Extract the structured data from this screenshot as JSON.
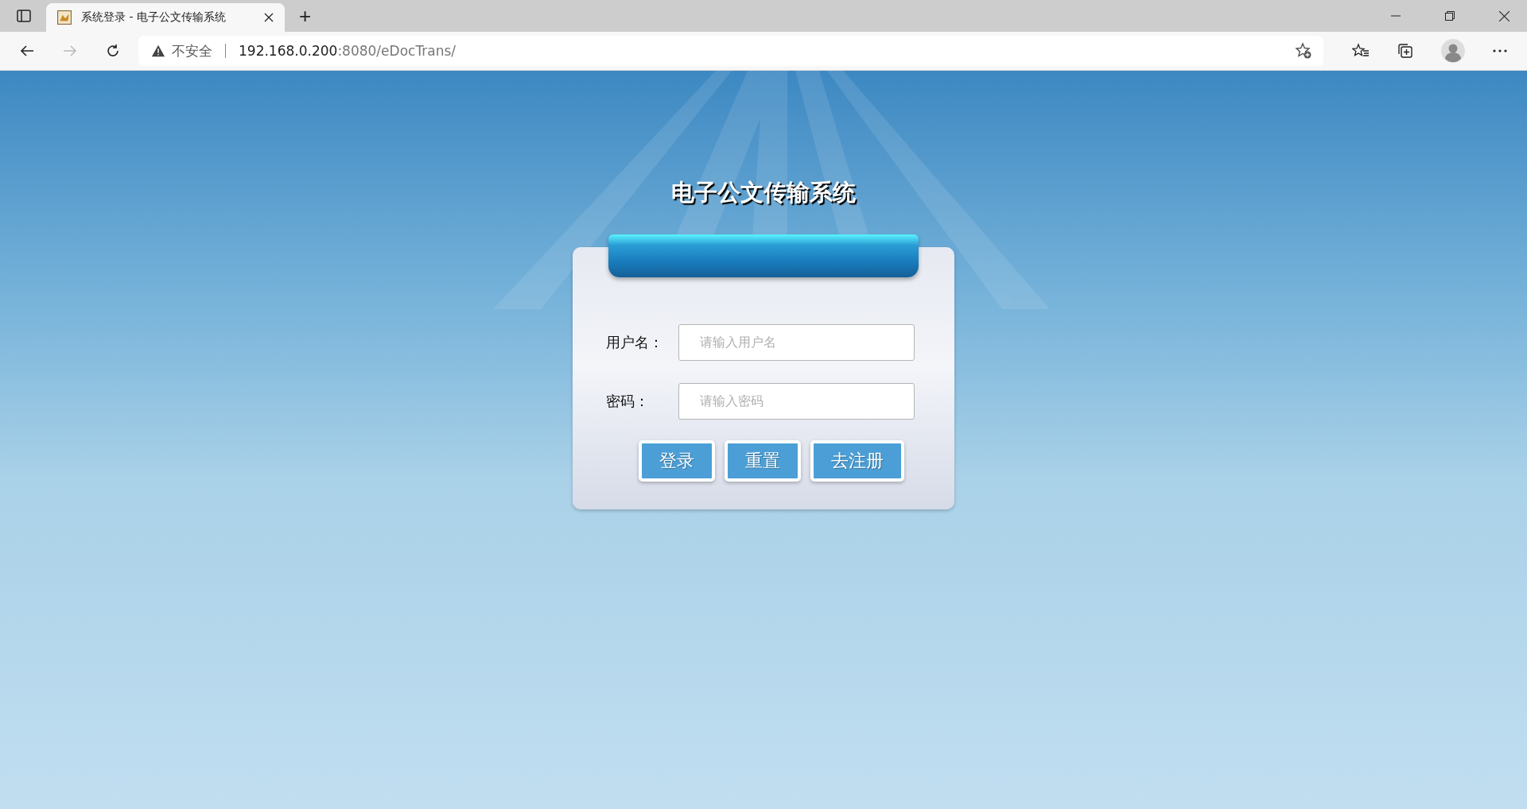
{
  "browser": {
    "tab": {
      "title": "系统登录 - 电子公文传输系统",
      "selected": true
    },
    "new_tab": "+",
    "address": {
      "security": "不安全",
      "host": "192.168.0.200",
      "path": ":8080/eDocTrans/"
    }
  },
  "page": {
    "title": "电子公文传输系统",
    "fields": [
      {
        "label": "用户名：",
        "placeholder": "请输入用户名"
      },
      {
        "label": "密码：",
        "placeholder": "请输入密码"
      }
    ],
    "buttons": [
      "登录",
      "重置",
      "去注册"
    ]
  }
}
